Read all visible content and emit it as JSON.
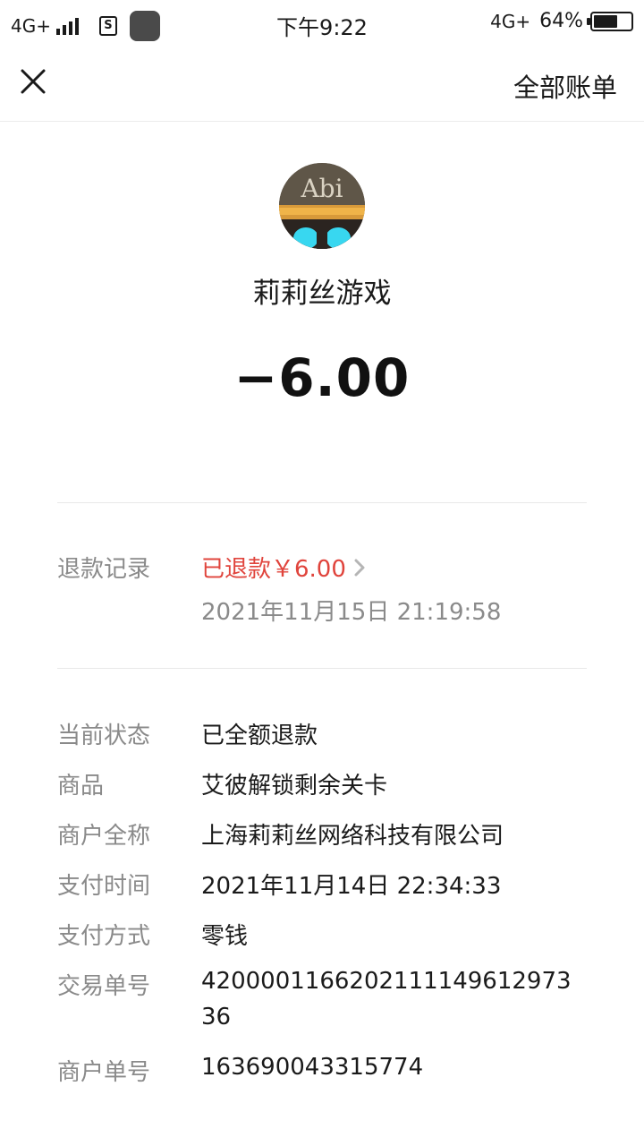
{
  "status_bar": {
    "network_left": "4G+",
    "time": "下午9:22",
    "network_right": "4G+",
    "battery": "64%",
    "battery_level": 0.64
  },
  "nav": {
    "close_icon": "close-icon",
    "all_bills": "全部账单"
  },
  "avatar": {
    "text": "Abi"
  },
  "merchant_name": "莉莉丝游戏",
  "amount": "−6.00",
  "refund": {
    "label": "退款记录",
    "text": "已退款￥6.00",
    "time": "2021年11月15日 21:19:58"
  },
  "details": [
    {
      "label": "当前状态",
      "value": "已全额退款"
    },
    {
      "label": "商品",
      "value": "艾彼解锁剩余关卡"
    },
    {
      "label": "商户全称",
      "value": "上海莉莉丝网络科技有限公司"
    },
    {
      "label": "支付时间",
      "value": "2021年11月14日 22:34:33"
    },
    {
      "label": "支付方式",
      "value": "零钱"
    },
    {
      "label": "交易单号",
      "value": "420000116620211114961297336"
    },
    {
      "label": "商户单号",
      "value": "163690043315774"
    }
  ],
  "colors": {
    "refund_red": "#e0443c",
    "label_gray": "#8a8a8a",
    "divider": "#e8e8e8"
  }
}
